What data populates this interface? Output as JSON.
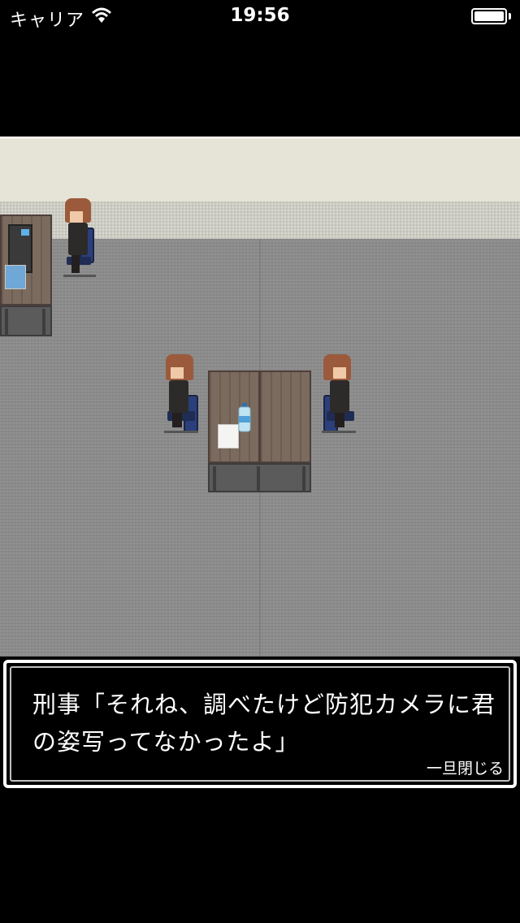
{
  "status_bar": {
    "carrier": "キャリア",
    "time": "19:56",
    "wifi_icon": "wifi-icon",
    "battery_icon": "battery-full-icon"
  },
  "scene": {
    "location": "office-interrogation-room",
    "characters": [
      "detective-at-desk",
      "player-seated-left",
      "detective-seated-right"
    ],
    "items": [
      "computer-monitor",
      "papers",
      "water-bottle"
    ]
  },
  "dialog": {
    "text": "刑事「それね、調べたけど防犯カメラに君の姿写ってなかったよ」",
    "close_label": "一旦閉じる"
  },
  "colors": {
    "wall": "#e6e4d6",
    "floor": "#8d8d8d",
    "desk": "#7b6a5e",
    "dialog_bg": "#000000",
    "dialog_border": "#ffffff"
  }
}
